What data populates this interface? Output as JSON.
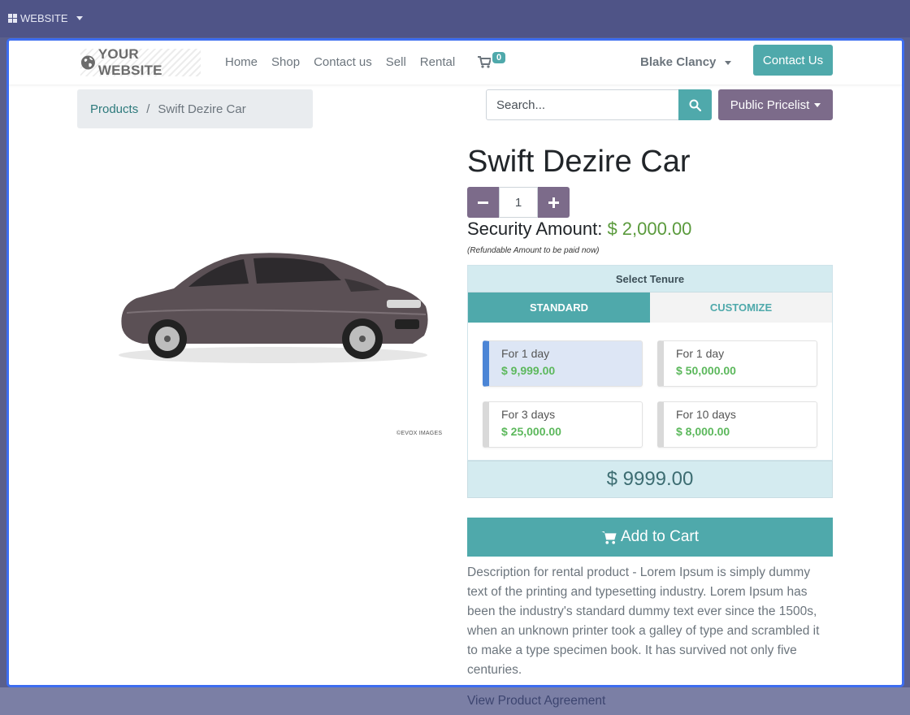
{
  "admin": {
    "website_label": "WEBSITE"
  },
  "header": {
    "logo_text": "YOUR WEBSITE",
    "nav": [
      "Home",
      "Shop",
      "Contact us",
      "Sell",
      "Rental"
    ],
    "cart_count": "0",
    "user_name": "Blake Clancy",
    "contact_button": "Contact Us"
  },
  "breadcrumb": {
    "parent": "Products",
    "separator": "/",
    "current": "Swift Dezire Car"
  },
  "search": {
    "placeholder": "Search..."
  },
  "pricelist": {
    "label": "Public Pricelist"
  },
  "product": {
    "title": "Swift Dezire Car",
    "quantity": "1",
    "security_label": "Security Amount:",
    "security_amount": "$ 2,000.00",
    "refund_note": "(Refundable Amount to be paid now)",
    "image_credit": "©EVOX IMAGES"
  },
  "tenure": {
    "heading": "Select Tenure",
    "tabs": {
      "standard": "STANDARD",
      "customize": "CUSTOMIZE"
    },
    "options": [
      {
        "label": "For 1 day",
        "price": "$ 9,999.00",
        "selected": true
      },
      {
        "label": "For 1 day",
        "price": "$ 50,000.00",
        "selected": false
      },
      {
        "label": "For 3 days",
        "price": "$ 25,000.00",
        "selected": false
      },
      {
        "label": "For 10 days",
        "price": "$ 8,000.00",
        "selected": false
      }
    ],
    "total": "$ 9999.00"
  },
  "cart": {
    "add_label": "Add to Cart"
  },
  "description": "Description for rental product - Lorem Ipsum is simply dummy text of the printing and typesetting industry. Lorem Ipsum has been the industry's standard dummy text ever since the 1500s, when an unknown printer took a galley of type and scrambled it to make a type specimen book. It has survived not only five centuries.",
  "agreement_link": "View Product Agreement",
  "colors": {
    "accent": "#4fa9ab",
    "secondary": "#7c6b8a",
    "admin_bar": "#4f5487",
    "frame_border": "#3d6df0",
    "price_green": "#5cb85c"
  }
}
